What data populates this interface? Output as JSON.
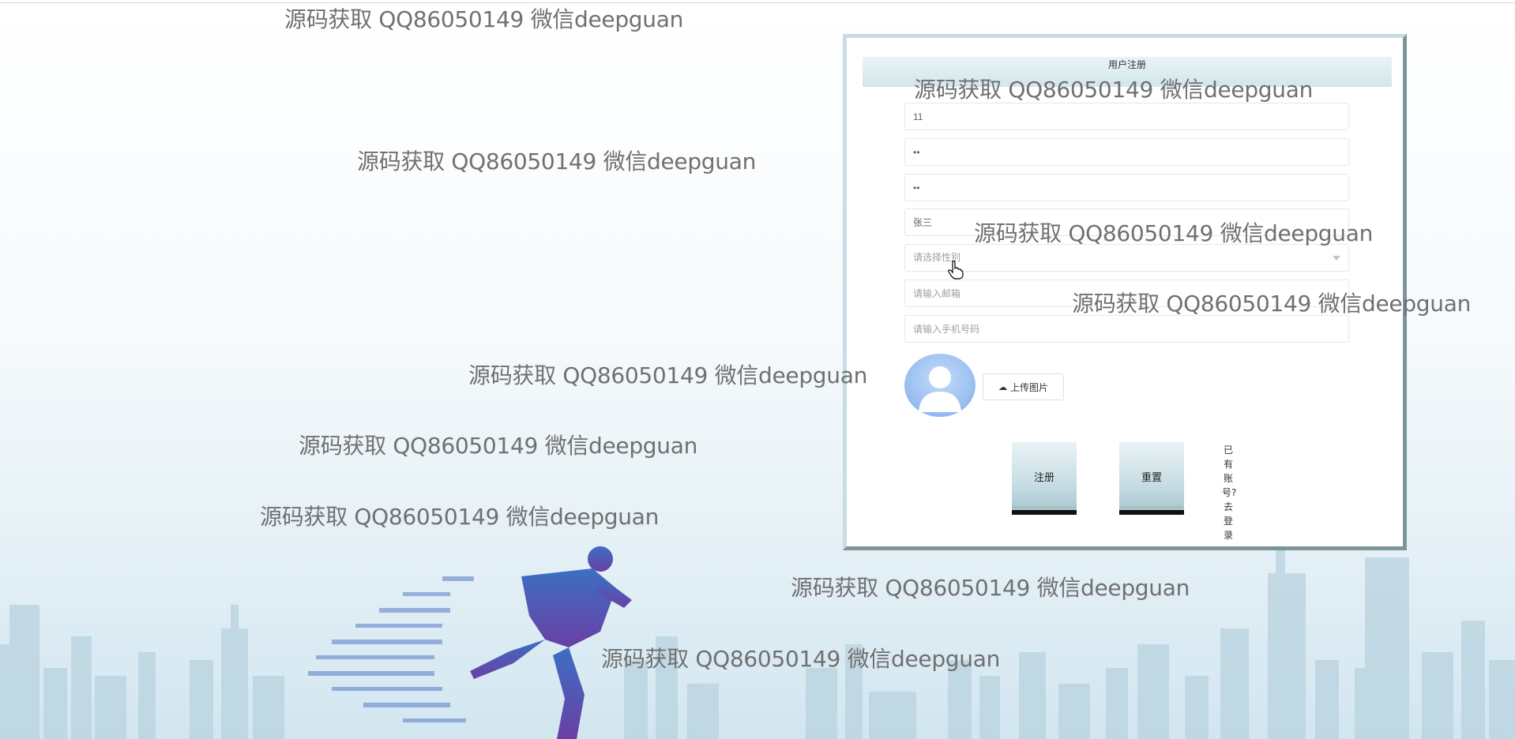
{
  "form": {
    "title": "用户注册",
    "account_value": "11",
    "password_value": "••",
    "confirm_password_value": "••",
    "name_value": "张三",
    "gender_placeholder": "请选择性别",
    "email_placeholder": "请输入邮箱",
    "phone_placeholder": "请输入手机号码",
    "upload_label": "上传图片",
    "upload_icon": "cloud-upload-icon",
    "register_label": "注册",
    "reset_label": "重置",
    "login_link": "已有账号?去登录"
  },
  "watermark_text": "源码获取 QQ86050149 微信deepguan",
  "colors": {
    "card_border_light": "#c6dde3",
    "card_border_dark": "#7d9599",
    "button_gradient": "#c8dee4"
  }
}
